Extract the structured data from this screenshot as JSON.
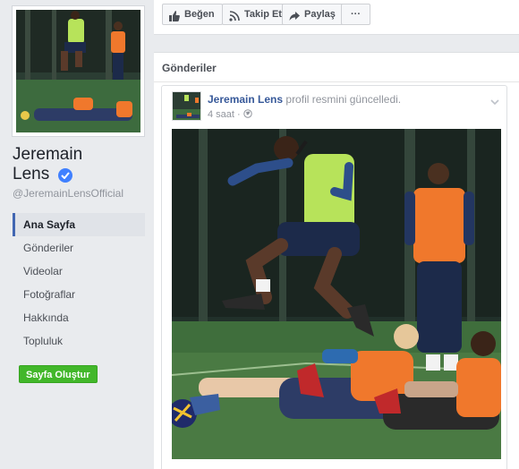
{
  "page": {
    "name": "Jeremain Lens",
    "handle": "@JeremainLensOfficial"
  },
  "nav": {
    "items": [
      {
        "label": "Ana Sayfa",
        "active": true
      },
      {
        "label": "Gönderiler",
        "active": false
      },
      {
        "label": "Videolar",
        "active": false
      },
      {
        "label": "Fotoğraflar",
        "active": false
      },
      {
        "label": "Hakkında",
        "active": false
      },
      {
        "label": "Topluluk",
        "active": false
      }
    ],
    "create_page_label": "Sayfa Oluştur"
  },
  "actions": {
    "like_label": "Beğen",
    "follow_label": "Takip Et",
    "share_label": "Paylaş",
    "more_label": "···"
  },
  "posts": {
    "title": "Gönderiler",
    "post": {
      "author": "Jeremain Lens",
      "action": "profil resmini güncelledi.",
      "time": "4 saat",
      "separator": "·"
    }
  },
  "colors": {
    "link": "#365899",
    "verified": "#4080ff",
    "create_button": "#42b72a",
    "nav_active_border": "#4267b2"
  },
  "icons": {
    "verified": "verified-badge-icon",
    "like": "thumbs-up-icon",
    "follow": "rss-icon",
    "share": "share-arrow-icon",
    "more": "ellipsis-icon",
    "privacy": "globe-icon",
    "menu": "chevron-down-icon"
  }
}
